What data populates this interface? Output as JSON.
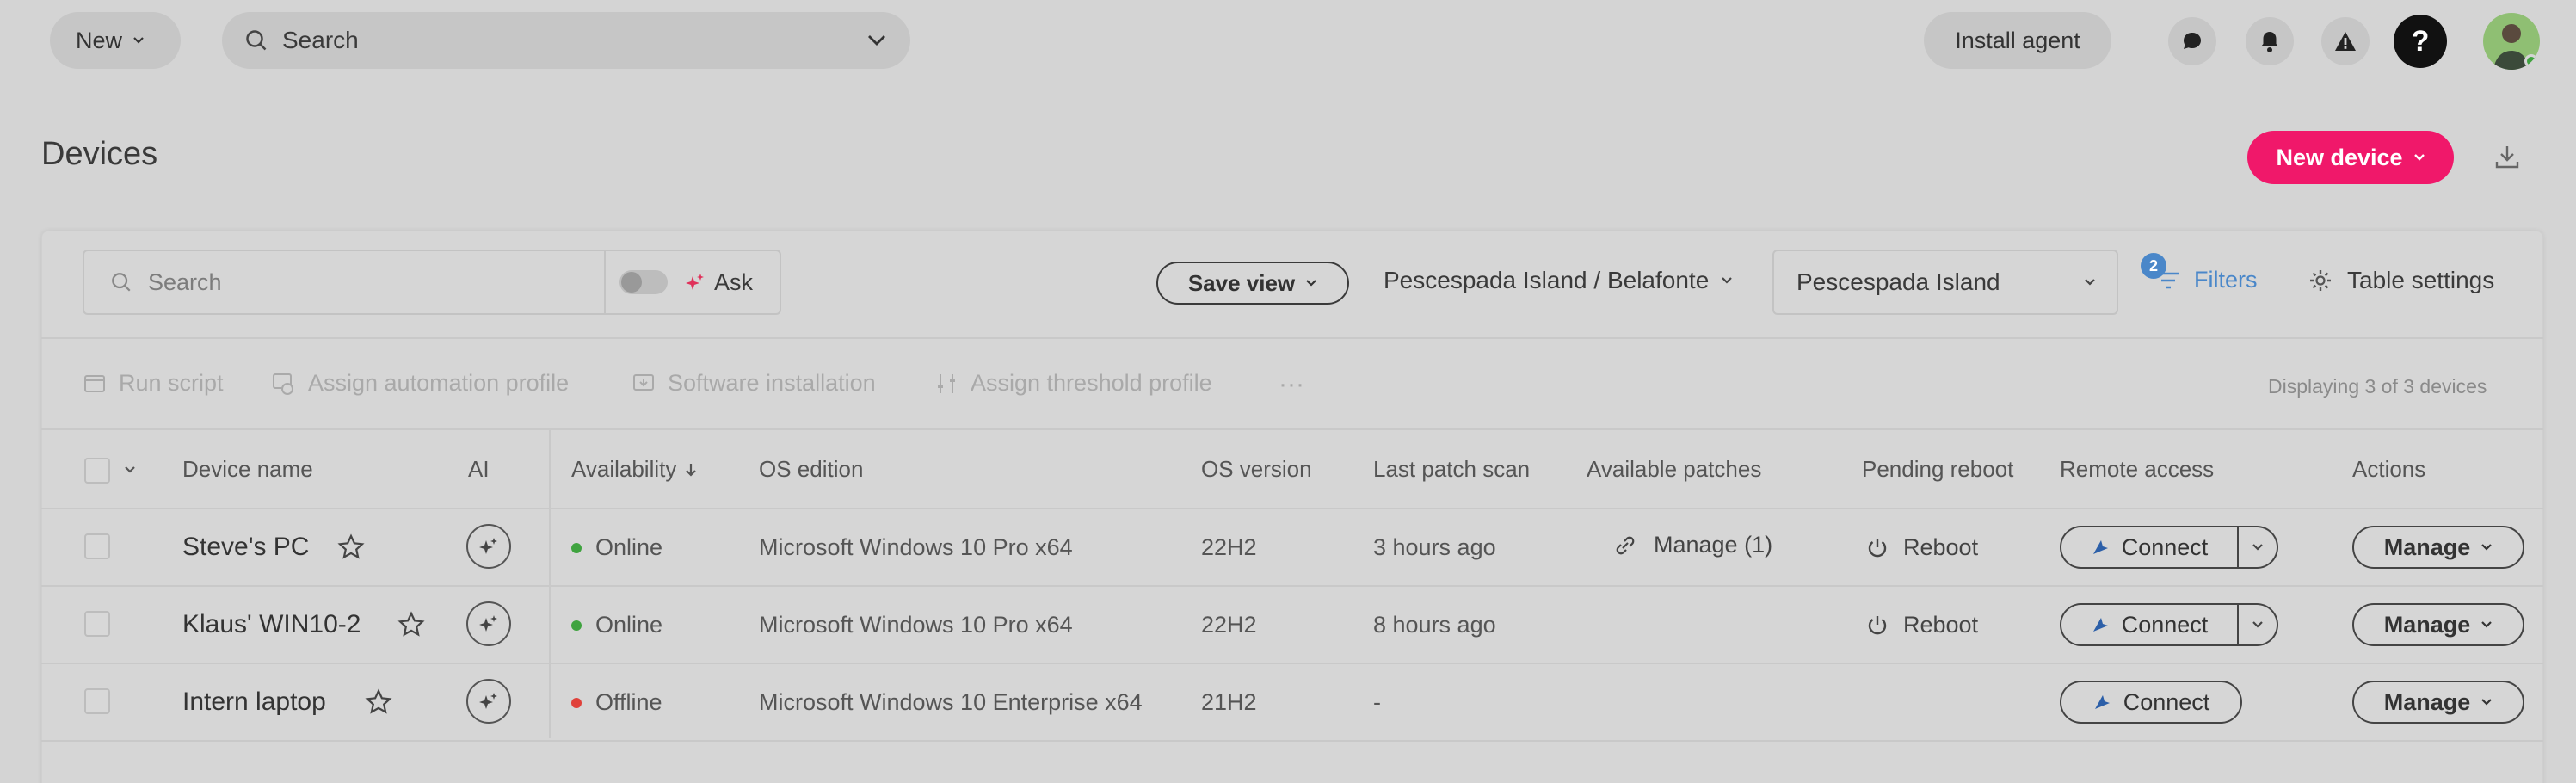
{
  "topbar": {
    "new_label": "New",
    "search_label": "Search",
    "install_agent": "Install agent",
    "help_symbol": "?"
  },
  "page": {
    "title": "Devices",
    "new_device": "New device"
  },
  "toolbar": {
    "search_placeholder": "Search",
    "ask_label": "Ask",
    "save_view": "Save view",
    "org_path": "Pescespada Island / Belafonte",
    "site_select": "Pescespada Island",
    "filters_count": "2",
    "filters_label": "Filters",
    "table_settings": "Table settings"
  },
  "bulk_actions": {
    "run_script": "Run script",
    "assign_automation": "Assign automation profile",
    "software_install": "Software installation",
    "assign_threshold": "Assign threshold profile",
    "more": "···",
    "displaying": "Displaying 3 of 3 devices"
  },
  "table": {
    "headers": {
      "device_name": "Device name",
      "ai": "AI",
      "availability": "Availability",
      "os_edition": "OS edition",
      "os_version": "OS version",
      "last_patch_scan": "Last patch scan",
      "available_patches": "Available patches",
      "pending_reboot": "Pending reboot",
      "remote_access": "Remote access",
      "actions": "Actions"
    },
    "rows": [
      {
        "name": "Steve's PC",
        "status": "Online",
        "os_edition": "Microsoft Windows 10 Pro x64",
        "os_version": "22H2",
        "last_scan": "3 hours ago",
        "patches": "Manage (1)",
        "reboot": "Reboot",
        "connect": "Connect",
        "manage": "Manage"
      },
      {
        "name": "Klaus' WIN10-2",
        "status": "Online",
        "os_edition": "Microsoft Windows 10 Pro x64",
        "os_version": "22H2",
        "last_scan": "8 hours ago",
        "patches": "",
        "reboot": "Reboot",
        "connect": "Connect",
        "manage": "Manage"
      },
      {
        "name": "Intern laptop",
        "status": "Offline",
        "os_edition": "Microsoft Windows 10 Enterprise x64",
        "os_version": "21H2",
        "last_scan": "-",
        "patches": "",
        "reboot": "",
        "connect": "Connect",
        "manage": "Manage"
      }
    ]
  },
  "colors": {
    "accent": "#f0186a",
    "link": "#4a87c9",
    "online": "#3fa33f",
    "offline": "#e0413a"
  }
}
